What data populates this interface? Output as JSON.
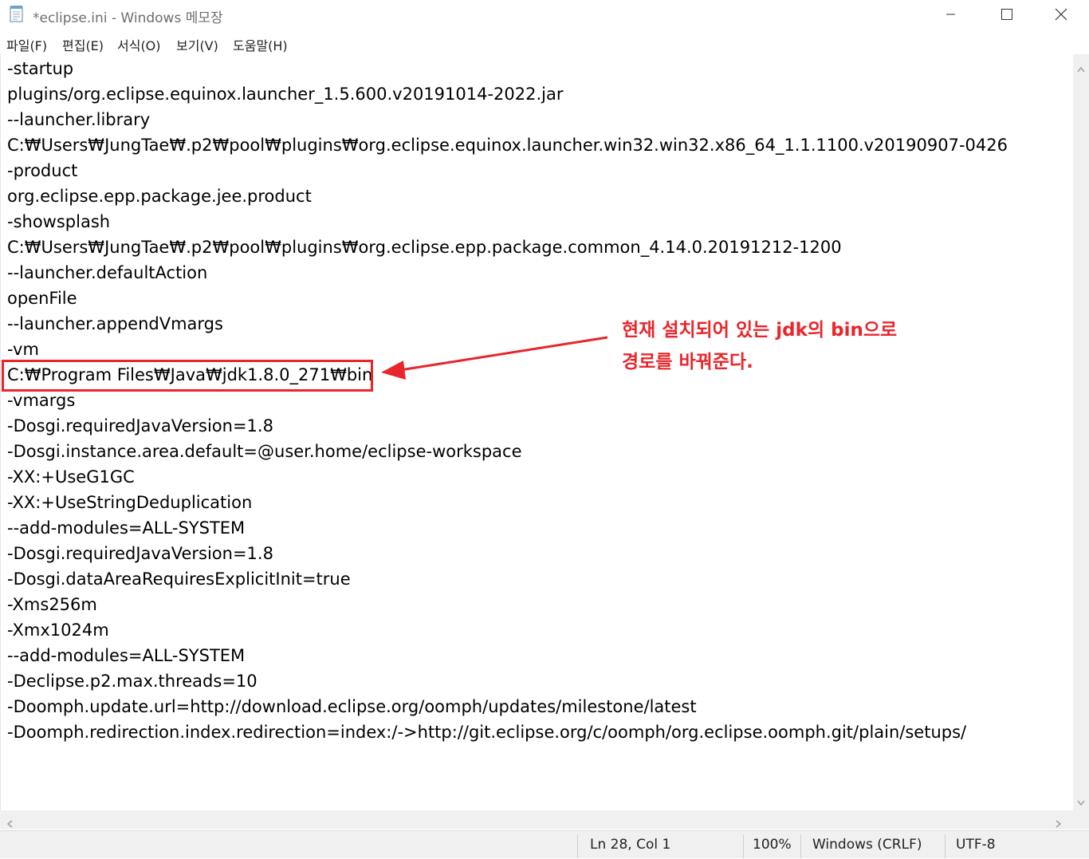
{
  "window": {
    "title": "*eclipse.ini - Windows 메모장",
    "icon": "notepad-icon",
    "controls": [
      "minimize-icon",
      "maximize-icon",
      "close-icon"
    ]
  },
  "menu": {
    "items": [
      "파일(F)",
      "편집(E)",
      "서식(O)",
      "보기(V)",
      "도움말(H)"
    ]
  },
  "editor": {
    "lines": [
      "-startup",
      "plugins/org.eclipse.equinox.launcher_1.5.600.v20191014-2022.jar",
      "--launcher.library",
      "C:₩Users₩JungTae₩.p2₩pool₩plugins₩org.eclipse.equinox.launcher.win32.win32.x86_64_1.1.1100.v20190907-0426",
      "-product",
      "org.eclipse.epp.package.jee.product",
      "-showsplash",
      "C:₩Users₩JungTae₩.p2₩pool₩plugins₩org.eclipse.epp.package.common_4.14.0.20191212-1200",
      "--launcher.defaultAction",
      "openFile",
      "--launcher.appendVmargs",
      "-vm",
      "C:₩Program Files₩Java₩jdk1.8.0_271₩bin",
      "-vmargs",
      "-Dosgi.requiredJavaVersion=1.8",
      "-Dosgi.instance.area.default=@user.home/eclipse-workspace",
      "-XX:+UseG1GC",
      "-XX:+UseStringDeduplication",
      "--add-modules=ALL-SYSTEM",
      "-Dosgi.requiredJavaVersion=1.8",
      "-Dosgi.dataAreaRequiresExplicitInit=true",
      "-Xms256m",
      "-Xmx1024m",
      "--add-modules=ALL-SYSTEM",
      "-Declipse.p2.max.threads=10",
      "-Doomph.update.url=http://download.eclipse.org/oomph/updates/milestone/latest",
      "-Doomph.redirection.index.redirection=index:/->http://git.eclipse.org/c/oomph/org.eclipse.oomph.git/plain/setups/"
    ],
    "highlighted_line_index": 12
  },
  "annotation": {
    "line1": "현재 설치되어 있는 jdk의 bin으로",
    "line2": "경로를 바꿔준다.",
    "color": "#e8262c"
  },
  "status": {
    "position": "Ln 28, Col 1",
    "zoom": "100%",
    "line_ending": "Windows (CRLF)",
    "encoding": "UTF-8"
  }
}
